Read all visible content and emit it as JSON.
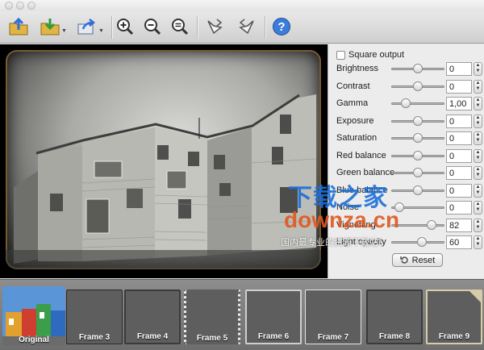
{
  "toolbar": {
    "buttons": [
      {
        "name": "open-icon"
      },
      {
        "name": "save-icon"
      },
      {
        "name": "share-icon"
      },
      {
        "name": "zoom-in-icon"
      },
      {
        "name": "zoom-out-icon"
      },
      {
        "name": "zoom-fit-icon"
      },
      {
        "name": "rotate-left-icon"
      },
      {
        "name": "rotate-right-icon"
      },
      {
        "name": "help-icon"
      }
    ],
    "help_glyph": "?"
  },
  "panel": {
    "square_output_label": "Square output",
    "sliders": [
      {
        "label": "Brightness",
        "value": "0",
        "level": 0.5
      },
      {
        "label": "Contrast",
        "value": "0",
        "level": 0.5
      },
      {
        "label": "Gamma",
        "value": "1,00",
        "level": 0.22
      },
      {
        "label": "Exposure",
        "value": "0",
        "level": 0.5
      },
      {
        "label": "Saturation",
        "value": "0",
        "level": 0.5
      },
      {
        "label": "Red balance",
        "value": "0",
        "level": 0.5
      },
      {
        "label": "Green balance",
        "value": "0",
        "level": 0.5
      },
      {
        "label": "Blue balance",
        "value": "0",
        "level": 0.5
      },
      {
        "label": "Noise",
        "value": "0",
        "level": 0.08
      },
      {
        "label": "Vignetting",
        "value": "82",
        "level": 0.82
      },
      {
        "label": "Light opacity",
        "value": "60",
        "level": 0.6
      }
    ],
    "reset_label": "Reset"
  },
  "watermark": {
    "line1": "下载之家",
    "line2": "downza.cn",
    "line3": "国内最专业的资源下载站！"
  },
  "frames": [
    {
      "label": "Original"
    },
    {
      "label": "Frame 3"
    },
    {
      "label": "Frame 4"
    },
    {
      "label": "Frame 5"
    },
    {
      "label": "Frame 6"
    },
    {
      "label": "Frame 7"
    },
    {
      "label": "Frame 8"
    },
    {
      "label": "Frame 9"
    }
  ]
}
